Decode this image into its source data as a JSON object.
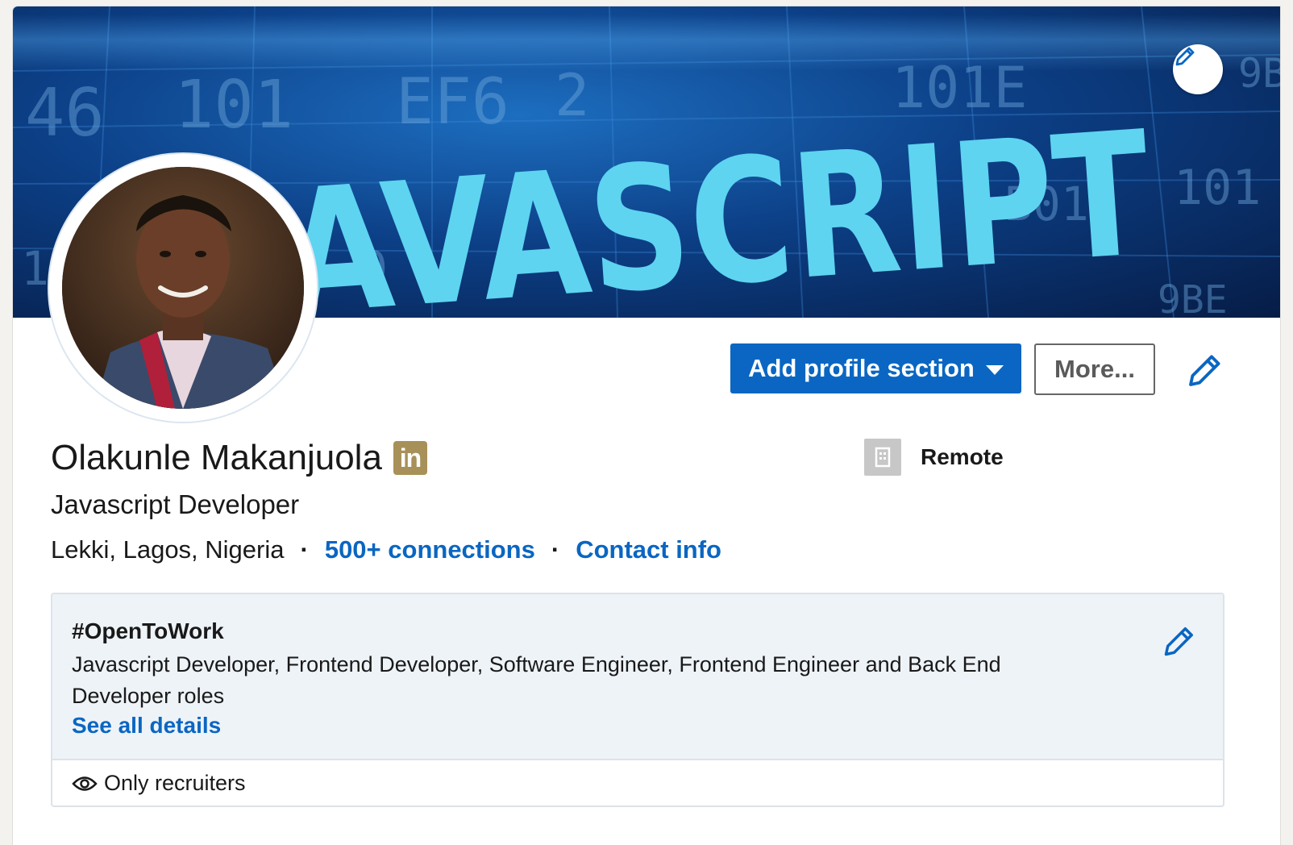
{
  "banner": {
    "title_text": "JAVASCRIPT",
    "code_fragments": [
      "46",
      "101",
      "EF6",
      "2",
      "101E",
      "101",
      "9B",
      "9BE",
      "B01",
      "10",
      "0"
    ],
    "edit_icon": "pencil-icon"
  },
  "profile": {
    "name": "Olakunle Makanjuola",
    "badge": "in",
    "headline": "Javascript Developer",
    "location": "Lekki, Lagos, Nigeria",
    "separator": "·",
    "connections": "500+ connections",
    "contact": "Contact info"
  },
  "company": {
    "name": "Remote",
    "logo_icon": "building-icon"
  },
  "actions": {
    "add_section": "Add profile section",
    "more": "More...",
    "edit_icon": "pencil-icon"
  },
  "open_to_work": {
    "title": "#OpenToWork",
    "description": "Javascript Developer, Frontend Developer, Software Engineer, Frontend Engineer and Back End Developer roles",
    "link": "See all details",
    "visibility": "Only recruiters",
    "visibility_icon": "eye-icon"
  },
  "colors": {
    "primary": "#0a66c2",
    "premium_badge": "#a89158",
    "open_to_work_bg": "#eef3f8"
  }
}
